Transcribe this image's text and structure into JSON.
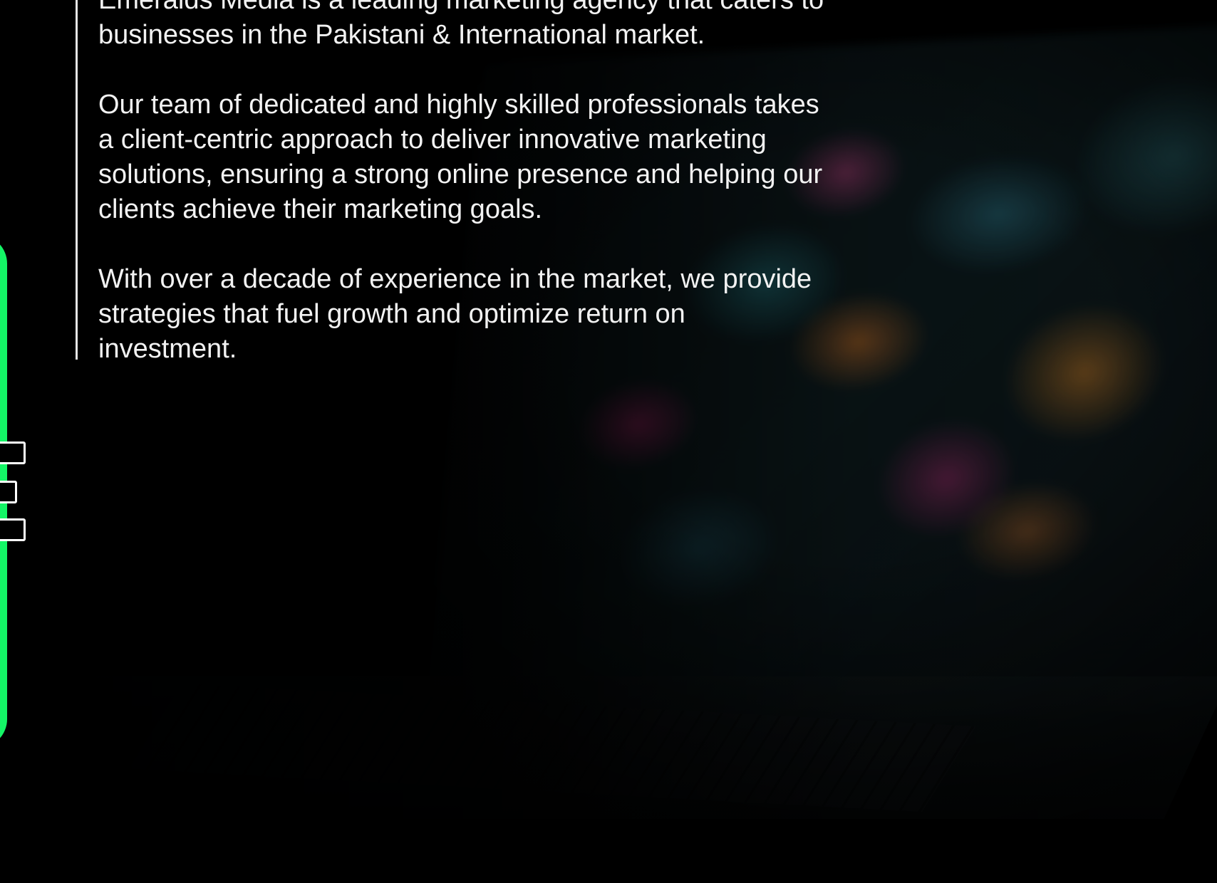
{
  "about": {
    "paragraph1": "Emeralds Media is a leading marketing agency that caters to\nbusinesses in the Pakistani & International market.",
    "paragraph2": "Our team of dedicated and highly skilled professionals takes\na client-centric approach to deliver innovative marketing\nsolutions, ensuring a strong online presence and helping our\nclients achieve their marketing goals.",
    "paragraph3": "With over a decade of experience in the market, we provide\nstrategies that fuel growth and optimize return on\ninvestment."
  },
  "colors": {
    "accent": "#14f566",
    "background": "#000000",
    "text": "#f2f2f2"
  }
}
